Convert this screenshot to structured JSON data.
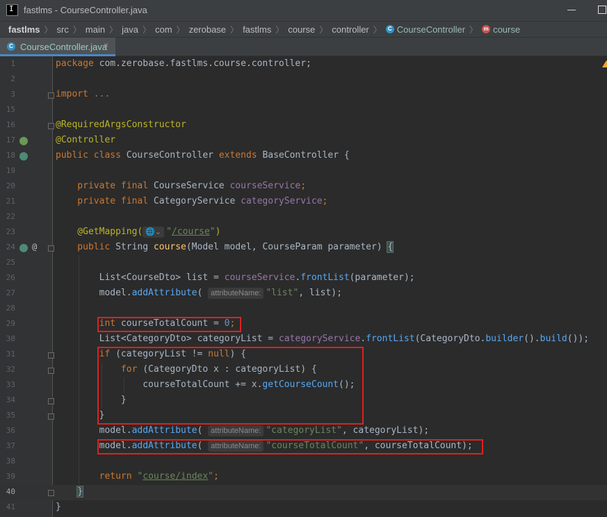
{
  "titlebar": {
    "title": "fastlms - CourseController.java"
  },
  "breadcrumb": {
    "items": [
      "fastlms",
      "src",
      "main",
      "java",
      "com",
      "zerobase",
      "fastlms",
      "course",
      "controller",
      "CourseController",
      "course"
    ]
  },
  "tab": {
    "label": "CourseController.java",
    "close": "×"
  },
  "icons": {
    "class_badge": "C",
    "method_badge": "m",
    "at": "@"
  },
  "hints": {
    "attributeName": "attributeName:"
  },
  "lines": {
    "n1": "1",
    "n2": "2",
    "n3": "3",
    "n15": "15",
    "n16": "16",
    "n17": "17",
    "n18": "18",
    "n19": "19",
    "n20": "20",
    "n21": "21",
    "n22": "22",
    "n23": "23",
    "n24": "24",
    "n25": "25",
    "n26": "26",
    "n27": "27",
    "n28": "28",
    "n29": "29",
    "n30": "30",
    "n31": "31",
    "n32": "32",
    "n33": "33",
    "n34": "34",
    "n35": "35",
    "n36": "36",
    "n37": "37",
    "n38": "38",
    "n39": "39",
    "n40": "40",
    "n41": "41"
  },
  "code": {
    "package_kw": "package",
    "package_name": " com.zerobase.fastlms.course.controller;",
    "import_kw": "import",
    "import_dots": " ...",
    "ann_rac": "@RequiredArgsConstructor",
    "ann_controller": "@Controller",
    "l18_public": "public",
    "l18_class": " class ",
    "l18_name": "CourseController ",
    "l18_extends": "extends",
    "l18_rest": " BaseController {",
    "l20_priv": "    private final ",
    "l20_type": "CourseService ",
    "l20_field": "courseService",
    "l20_semi": ";",
    "l21_priv": "    private final ",
    "l21_type": "CategoryService ",
    "l21_field": "categoryService",
    "l21_semi": ";",
    "l23_ann": "    @GetMapping(",
    "l23_globe": "🌐⌄",
    "l23_q1": "\"",
    "l23_path": "/course",
    "l23_q2": "\"",
    "l23_close": ")",
    "l24_public": "    public ",
    "l24_type": "String ",
    "l24_name": "course",
    "l24_params": "(Model model, CourseParam parameter) ",
    "l24_brace": "{",
    "l26_a": "        List<CourseDto> list = ",
    "l26_field": "courseService",
    "l26_dot": ".",
    "l26_call": "frontList",
    "l26_rest": "(parameter);",
    "l27_a": "        model.",
    "l27_call": "addAttribute",
    "l27_open": "( ",
    "l27_str": "\"list\"",
    "l27_rest": ", list);",
    "l29_indent": "        ",
    "l29_kw": "int",
    "l29_mid": " courseTotalCount = ",
    "l29_num": "0",
    "l29_semi": ";",
    "l30_a": "        List<CategoryDto> categoryList = ",
    "l30_field": "categoryService",
    "l30_dot": ".",
    "l30_call": "frontList",
    "l30_mid": "(CategoryDto.",
    "l30_builder": "builder",
    "l30_mid2": "().",
    "l30_build": "build",
    "l30_end": "());",
    "l31_indent": "        ",
    "l31_if": "if",
    "l31_mid": " (categoryList != ",
    "l31_null": "null",
    "l31_end": ") {",
    "l32_indent": "            ",
    "l32_for": "for",
    "l32_rest": " (CategoryDto x : categoryList) {",
    "l33_a": "                courseTotalCount += x.",
    "l33_call": "getCourseCount",
    "l33_rest": "();",
    "l34": "            }",
    "l35": "        }",
    "l36_a": "        model.",
    "l36_call": "addAttribute",
    "l36_open": "( ",
    "l36_str": "\"categoryList\"",
    "l36_rest": ", categoryList);",
    "l37_a": "        model.",
    "l37_call": "addAttribute",
    "l37_open": "( ",
    "l37_str": "\"courseTotalCount\"",
    "l37_rest": ", courseTotalCount);",
    "l39_indent": "        ",
    "l39_ret": "return",
    "l39_sp": " ",
    "l39_q1": "\"",
    "l39_path": "course/index",
    "l39_q2": "\"",
    "l39_semi": ";",
    "l40_indent": "    ",
    "l40_brace": "}",
    "l41": "}"
  },
  "colors": {
    "highlight_box": "#e02020",
    "accent_tab": "#4a88c7",
    "warning": "#f0a732"
  }
}
